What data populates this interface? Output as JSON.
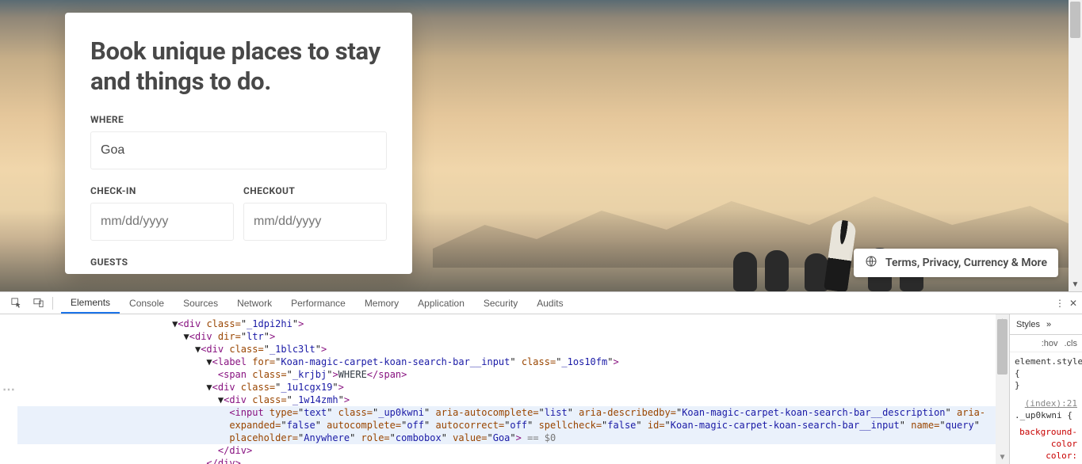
{
  "hero": {
    "headline": "Book unique places to stay and things to do.",
    "where_label": "WHERE",
    "where_value": "Goa",
    "where_placeholder": "Anywhere",
    "checkin_label": "CHECK-IN",
    "checkout_label": "CHECKOUT",
    "date_placeholder": "mm/dd/yyyy",
    "guests_label": "GUESTS"
  },
  "footer_chip": "Terms, Privacy, Currency & More",
  "devtools": {
    "tabs": [
      "Elements",
      "Console",
      "Sources",
      "Network",
      "Performance",
      "Memory",
      "Application",
      "Security",
      "Audits"
    ],
    "active_tab": "Elements",
    "gutter": "⋯",
    "styles_tab": "Styles",
    "styles_more": "»",
    "hov_label": ":hov",
    "cls_label": ".cls",
    "styles_rules": {
      "r1_sel": "element.style",
      "r1_body": "",
      "r2_link": "(index):21",
      "r2_sel": "._up0kwni",
      "r2_prop1": "background-color"
    },
    "dom": {
      "l1_indent": "                           ▼",
      "l1_tag_open": "<div ",
      "l1_attr": "class",
      "l1_val": "_1dpi2hi",
      "l2_indent": "                             ▼",
      "l2_tag_open": "<div ",
      "l2_attr": "dir",
      "l2_val": "ltr",
      "l3_indent": "                               ▼",
      "l3_tag_open": "<div ",
      "l3_attr": "class",
      "l3_val": "_1blc3lt",
      "l4_indent": "                                 ▼",
      "l4_tag_open": "<label ",
      "l4_a1": "for",
      "l4_v1": "Koan-magic-carpet-koan-search-bar__input",
      "l4_a2": "class",
      "l4_v2": "_1os10fm",
      "l5_indent": "                                   ",
      "l5_tag_open": "<span ",
      "l5_attr": "class",
      "l5_val": "_krjbj",
      "l5_text": "WHERE",
      "l6_indent": "                                 ▼",
      "l6_tag_open": "<div ",
      "l6_attr": "class",
      "l6_val": "_1u1cgx19",
      "l7_indent": "                                   ▼",
      "l7_tag_open": "<div ",
      "l7_attr": "class",
      "l7_val": "_1w14zmh",
      "l8_indent": "                                     ",
      "l8_tag_open": "<input ",
      "l8_pairs": [
        [
          "type",
          "text"
        ],
        [
          "class",
          "_up0kwni"
        ],
        [
          "aria-autocomplete",
          "list"
        ],
        [
          "aria-describedby",
          "Koan-magic-carpet-koan-search-bar__description"
        ],
        [
          "aria-expanded",
          "false"
        ],
        [
          "autocomplete",
          "off"
        ],
        [
          "autocorrect",
          "off"
        ],
        [
          "spellcheck",
          "false"
        ],
        [
          "id",
          "Koan-magic-carpet-koan-search-bar__input"
        ],
        [
          "name",
          "query"
        ],
        [
          "placeholder",
          "Anywhere"
        ],
        [
          "role",
          "combobox"
        ],
        [
          "value",
          "Goa"
        ]
      ],
      "l8_trail": " == $0",
      "l9_indent": "                                   ",
      "l9_text": "</div>",
      "l10_indent": "                                 ",
      "l10_text": "</div>"
    }
  }
}
